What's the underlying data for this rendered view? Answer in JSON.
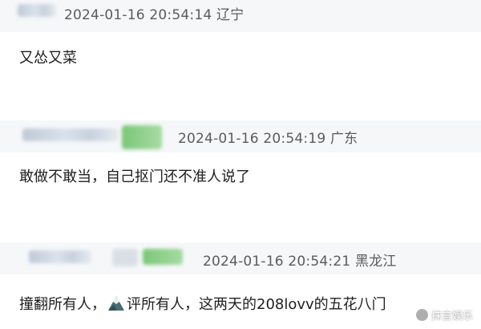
{
  "comments": [
    {
      "timestamp": "2024-01-16 20:54:14",
      "location": "辽宁",
      "text": "又怂又菜"
    },
    {
      "timestamp": "2024-01-16 20:54:19",
      "location": "广东",
      "text": "敢做不敢当，自己抠门还不准人说了"
    },
    {
      "timestamp": "2024-01-16 20:54:21",
      "location": "黑龙江",
      "text_before_icon": "撞翻所有人，",
      "text_after_icon": "评所有人，这两天的208lovv的五花八门"
    }
  ],
  "watermark": "抹言娱乐",
  "icons": {
    "inline_emoji": "mountain-icon",
    "watermark_logo": "watermark-logo-icon"
  },
  "colors": {
    "header_bg": "#f5f7f9",
    "meta_text": "#5b5b5b",
    "badge_green": "#6fc26a"
  }
}
